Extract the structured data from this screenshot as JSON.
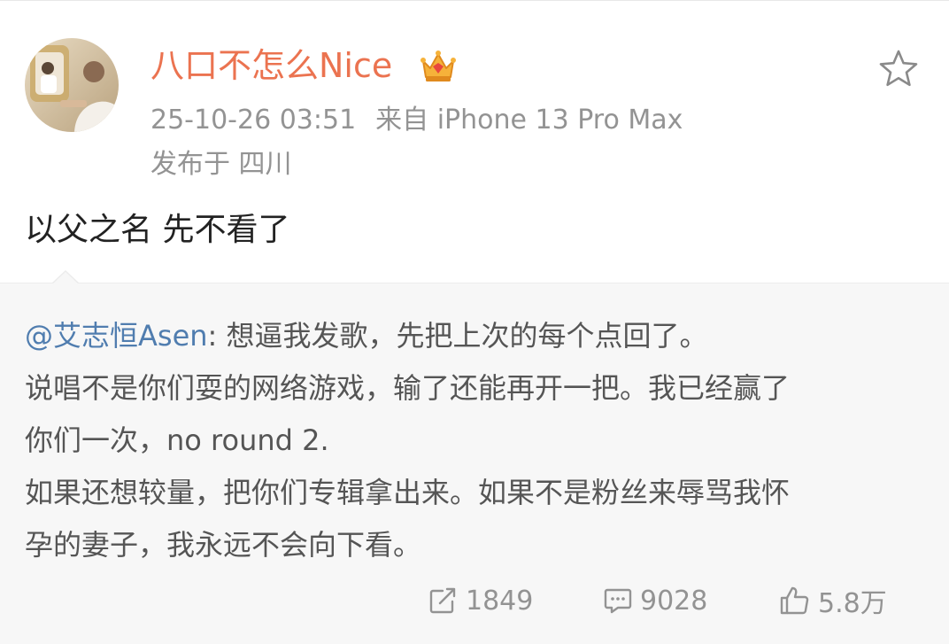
{
  "header": {
    "username": "八口不怎么Nice",
    "timestamp": "25-10-26 03:51",
    "source": "来自 iPhone 13 Pro Max",
    "location": "发布于 四川"
  },
  "post": {
    "text": "以父之名 先不看了"
  },
  "repost": {
    "author": "@艾志恒Asen",
    "lines": [
      ": 想逼我发歌，先把上次的每个点回了。",
      "说唱不是你们耍的网络游戏，输了还能再开一把。我已经赢了",
      "你们一次，no round 2.",
      "如果还想较量，把你们专辑拿出来。如果不是粉丝来辱骂我怀",
      "孕的妻子，我永远不会向下看。"
    ],
    "stats": {
      "reposts": "1849",
      "comments": "9028",
      "likes": "5.8万"
    }
  },
  "icons": {
    "vip": "crown-badge-icon",
    "favorite": "star-icon",
    "repost": "repost-icon",
    "comment": "comment-icon",
    "like": "thumbs-up-icon"
  },
  "colors": {
    "username": "#eb7350",
    "link": "#507daf",
    "meta": "#939393",
    "repost_bg": "#f7f7f7"
  }
}
